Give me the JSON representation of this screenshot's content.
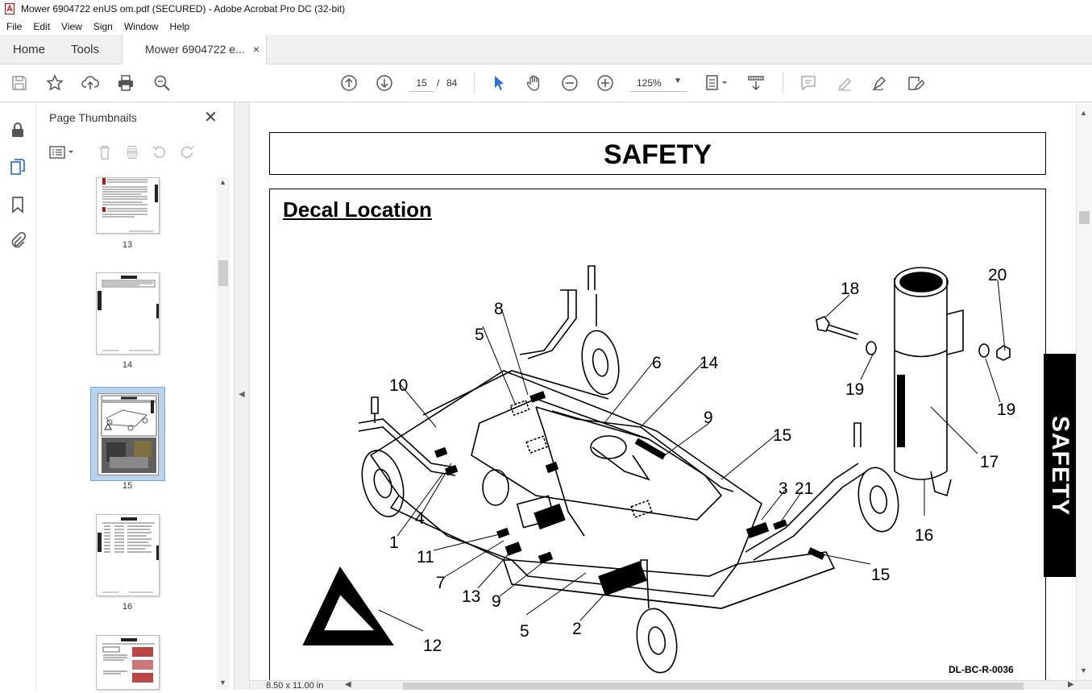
{
  "window": {
    "title": "Mower 6904722 enUS om.pdf (SECURED) - Adobe Acrobat Pro DC (32-bit)"
  },
  "menu": [
    "File",
    "Edit",
    "View",
    "Sign",
    "Window",
    "Help"
  ],
  "tabs": {
    "home": "Home",
    "tools": "Tools",
    "document": "Mower 6904722 e...",
    "close": "×"
  },
  "toolbar": {
    "icons": [
      "save-icon",
      "star-icon",
      "upload-icon",
      "print-icon",
      "search-icon",
      "page-up-icon",
      "page-down-icon",
      "pointer-icon",
      "hand-icon",
      "zoom-out-icon",
      "zoom-in-icon",
      "fit-page-icon",
      "scroll-mode-icon",
      "comment-icon",
      "highlight-icon",
      "draw-icon",
      "edit-sign-icon"
    ],
    "page_current": "15",
    "page_sep": "/",
    "page_total": "84",
    "zoom": "125%"
  },
  "thumbnails": {
    "title": "Page Thumbnails",
    "close": "✕",
    "pages": [
      "13",
      "14",
      "15",
      "16"
    ],
    "selected": "15"
  },
  "document": {
    "header": "SAFETY",
    "section_title": "Decal Location",
    "drawing_id": "DL-BC-R-0036",
    "side_tab": "SAFETY",
    "callouts": [
      "1",
      "2",
      "3",
      "4",
      "5",
      "5",
      "6",
      "7",
      "8",
      "9",
      "9",
      "10",
      "11",
      "12",
      "13",
      "14",
      "15",
      "15",
      "16",
      "17",
      "18",
      "19",
      "19",
      "20",
      "21"
    ]
  },
  "status": {
    "page_size": "8.50 x 11.00 in"
  }
}
